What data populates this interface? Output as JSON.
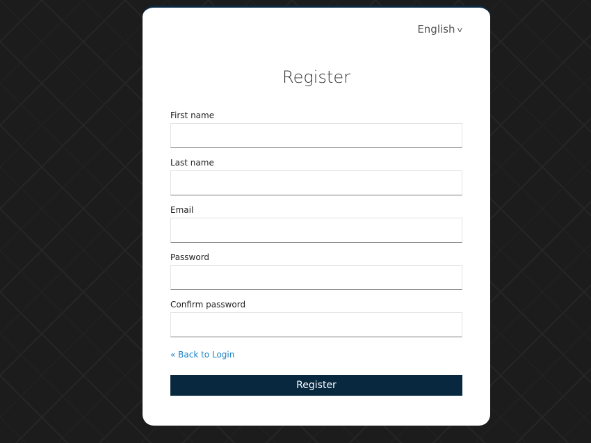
{
  "header": {
    "language": "English",
    "language_icon": "chevron-down-icon"
  },
  "title": "Register",
  "form": {
    "fields": [
      {
        "label": "First name",
        "value": "",
        "placeholder": ""
      },
      {
        "label": "Last name",
        "value": "",
        "placeholder": ""
      },
      {
        "label": "Email",
        "value": "",
        "placeholder": ""
      },
      {
        "label": "Password",
        "value": "",
        "placeholder": ""
      },
      {
        "label": "Confirm password",
        "value": "",
        "placeholder": ""
      }
    ],
    "back_link": "« Back to Login",
    "submit_label": "Register"
  },
  "colors": {
    "background": "#1c1c1c",
    "card": "#ffffff",
    "primary": "#082840",
    "link": "#1a83c6"
  }
}
